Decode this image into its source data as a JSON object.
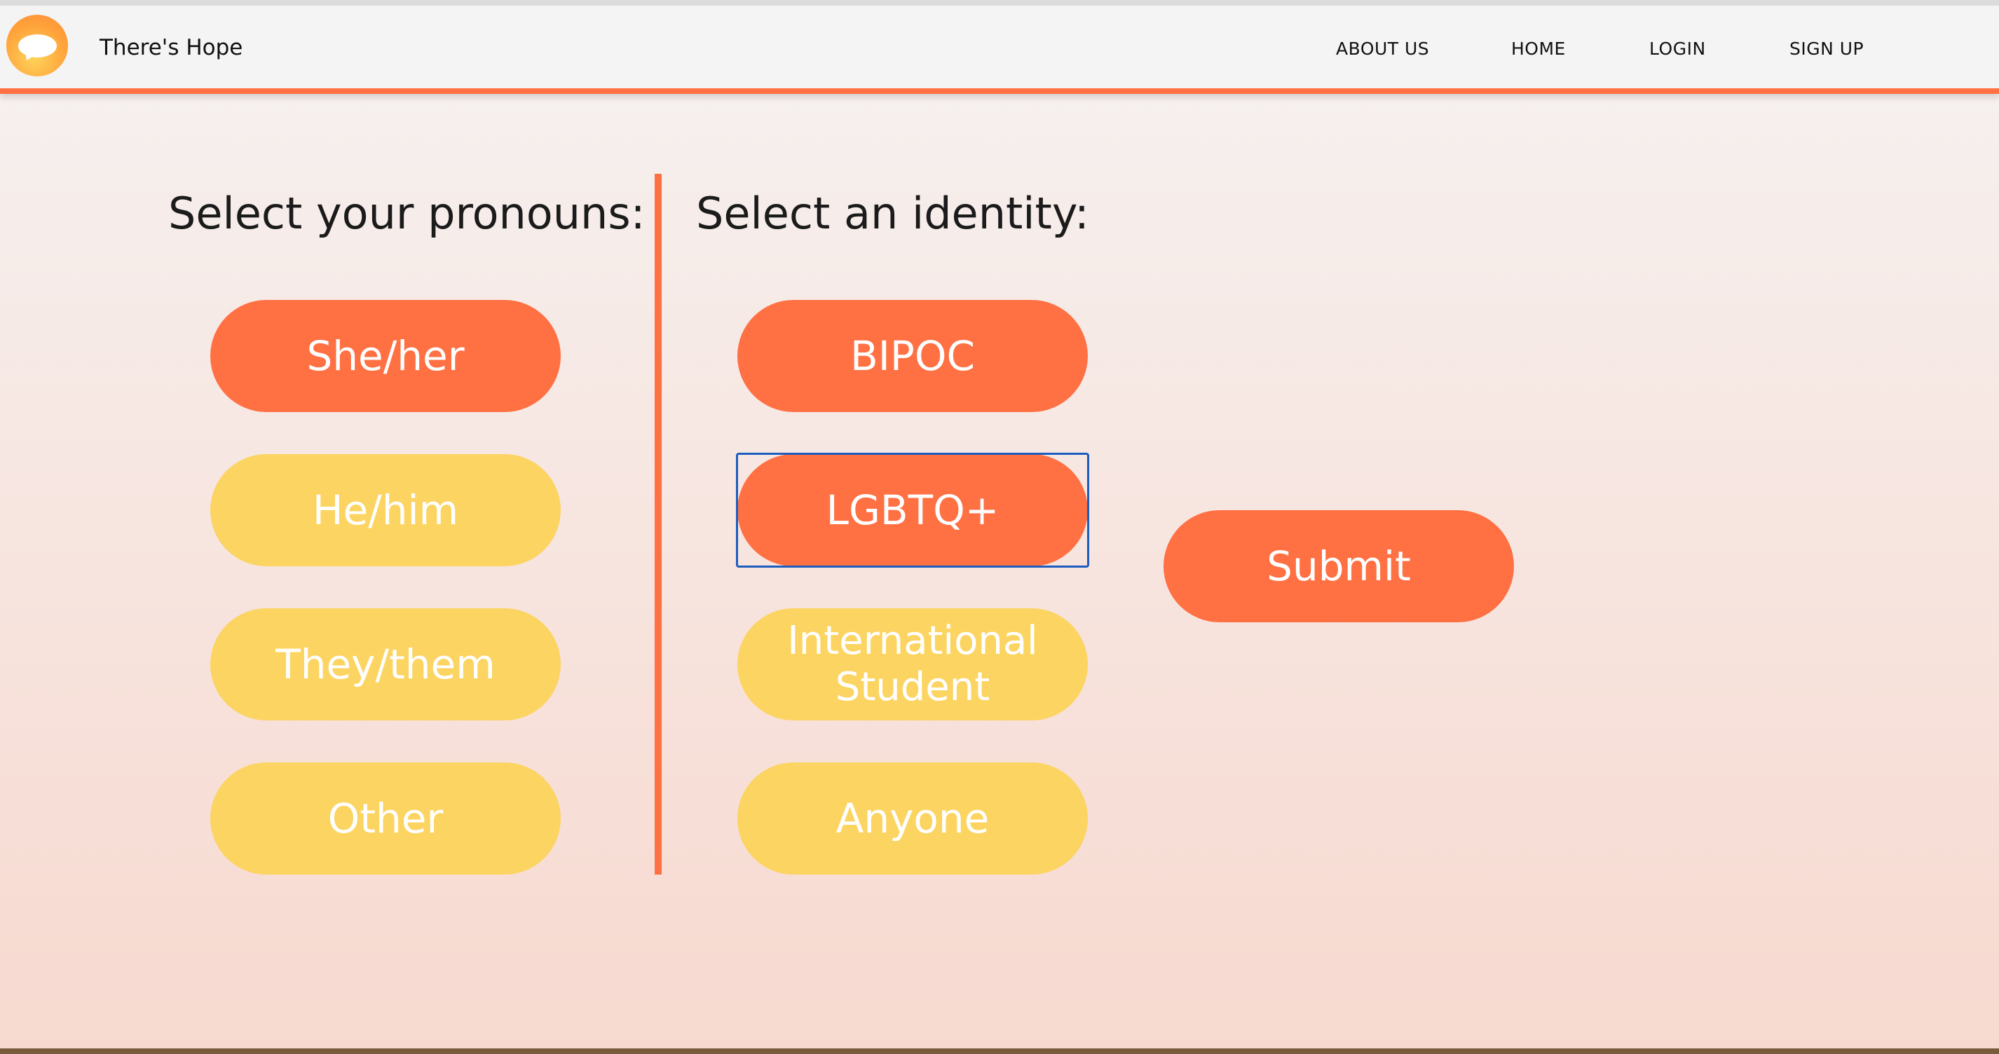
{
  "header": {
    "brand": "There's Hope",
    "nav": [
      "ABOUT US",
      "HOME",
      "LOGIN",
      "SIGN UP"
    ]
  },
  "pronouns": {
    "heading": "Select your pronouns:",
    "options": [
      {
        "label": "She/her",
        "selected": true
      },
      {
        "label": "He/him",
        "selected": false
      },
      {
        "label": "They/them",
        "selected": false
      },
      {
        "label": "Other",
        "selected": false
      }
    ]
  },
  "identity": {
    "heading": "Select an identity:",
    "options": [
      {
        "label": "BIPOC",
        "selected": true
      },
      {
        "label": "LGBTQ+",
        "selected": true,
        "focused": true
      },
      {
        "label": "International Student",
        "selected": false
      },
      {
        "label": "Anyone",
        "selected": false
      }
    ]
  },
  "submit": {
    "label": "Submit"
  },
  "colors": {
    "accent": "#ff7043",
    "unselected": "#fcd462",
    "focus": "#1c5dbf"
  },
  "icons": {
    "logo": "speech-bubble-icon"
  }
}
